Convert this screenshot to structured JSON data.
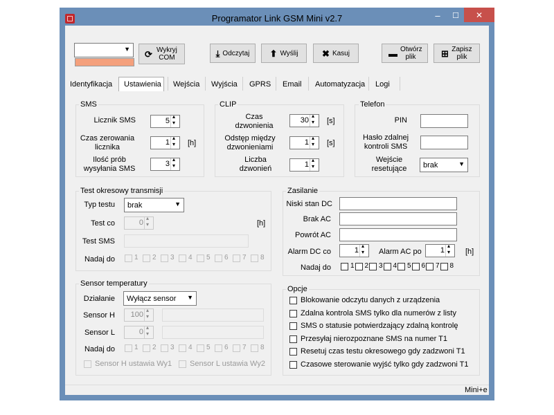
{
  "window": {
    "title": "Programator Link GSM Mini v2.7",
    "frame_color": "#6b8fb8",
    "close_color": "#c7504b"
  },
  "titlebar": {
    "minimize": "–",
    "maximize": "☐",
    "close": "✕"
  },
  "toolbar": {
    "port_value": "",
    "detect_com": "Wykryj COM",
    "read": "Odczytaj",
    "send": "Wyślij",
    "erase": "Kasuj",
    "open_file": "Otwórz plik",
    "save_file": "Zapisz plik",
    "status_color": "#f4a07c"
  },
  "tabs": [
    "Identyfikacja",
    "Ustawienia",
    "Wejścia",
    "Wyjścia",
    "GPRS",
    "Email",
    "Automatyzacja",
    "Logi"
  ],
  "active_tab": "Ustawienia",
  "sms": {
    "title": "SMS",
    "counter_label": "Licznik SMS",
    "counter_value": "5",
    "reset_time_label": "Czas zerowania licznika",
    "reset_time_value": "1",
    "reset_time_unit": "[h]",
    "attempts_label": "Ilość prób wysyłania SMS",
    "attempts_value": "3"
  },
  "clip": {
    "title": "CLIP",
    "ring_time_label": "Czas dzwonienia",
    "ring_time_value": "30",
    "ring_time_unit": "[s]",
    "interval_label": "Odstęp między dzwonieniami",
    "interval_value": "1",
    "interval_unit": "[s]",
    "calls_label": "Liczba dzwonień",
    "calls_value": "1"
  },
  "phone": {
    "title": "Telefon",
    "pin_label": "PIN",
    "pin_value": "",
    "remote_pass_label": "Hasło zdalnej kontroli SMS",
    "remote_pass_value": "",
    "reset_input_label": "Wejście resetujące",
    "reset_input_value": "brak"
  },
  "periodic": {
    "title": "Test okresowy transmisji",
    "type_label": "Typ testu",
    "type_value": "brak",
    "every_label": "Test co",
    "every_value": "0",
    "every_unit": "[h]",
    "sms_label": "Test SMS",
    "sms_value": "",
    "send_to_label": "Nadaj do",
    "numbers": [
      "1",
      "2",
      "3",
      "4",
      "5",
      "6",
      "7",
      "8"
    ]
  },
  "power": {
    "title": "Zasilanie",
    "low_dc_label": "Niski stan DC",
    "low_dc_value": "",
    "no_ac_label": "Brak AC",
    "no_ac_value": "",
    "ac_return_label": "Powrót AC",
    "ac_return_value": "",
    "alarm_dc_label": "Alarm DC co",
    "alarm_dc_value": "1",
    "alarm_ac_label": "Alarm AC po",
    "alarm_ac_value": "1",
    "alarm_unit": "[h]",
    "send_to_label": "Nadaj do",
    "numbers": [
      "1",
      "2",
      "3",
      "4",
      "5",
      "6",
      "7",
      "8"
    ]
  },
  "sensor": {
    "title": "Sensor temperatury",
    "action_label": "Działanie",
    "action_value": "Wyłącz sensor",
    "h_label": "Sensor H",
    "h_value": "100",
    "l_label": "Sensor L",
    "l_value": "0",
    "send_to_label": "Nadaj do",
    "numbers": [
      "1",
      "2",
      "3",
      "4",
      "5",
      "6",
      "7",
      "8"
    ],
    "h_sets_out": "Sensor H ustawia Wy1",
    "l_sets_out": "Sensor L ustawia Wy2"
  },
  "options": {
    "title": "Opcje",
    "items": [
      "Blokowanie odczytu danych z urządzenia",
      "Zdalna kontrola SMS tylko dla numerów z listy",
      "SMS o statusie potwierdzający zdalną kontrolę",
      "Przesyłaj nierozpoznane SMS na numer T1",
      "Resetuj czas testu okresowego gdy zadzwoni T1",
      "Czasowe sterowanie wyjść tylko gdy zadzwoni T1"
    ]
  },
  "status": {
    "device": "Mini+e"
  }
}
